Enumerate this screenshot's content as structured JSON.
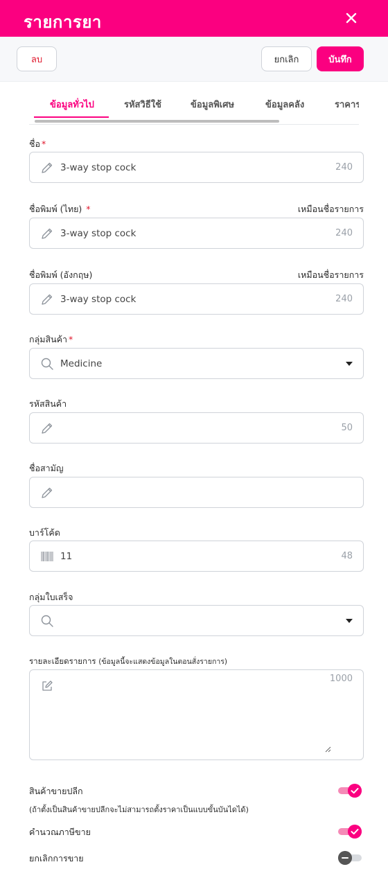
{
  "header": {
    "title": "รายการยา",
    "close_icon": "close-icon"
  },
  "toolbar": {
    "delete_label": "ลบ",
    "cancel_label": "ยกเลิก",
    "save_label": "บันทึก"
  },
  "tabs": [
    {
      "label": "ข้อมูลทั่วไป",
      "active": true
    },
    {
      "label": "รหัสวิธีใช้",
      "active": false
    },
    {
      "label": "ข้อมูลพิเศษ",
      "active": false
    },
    {
      "label": "ข้อมูลคลัง",
      "active": false
    },
    {
      "label": "ราคาร",
      "active": false
    }
  ],
  "form": {
    "name": {
      "label": "ชื่อ",
      "required_mark": "*",
      "value": "3-way stop cock",
      "max": "240",
      "icon": "pencil-icon"
    },
    "print_name_th": {
      "label": "ชื่อพิมพ์ (ไทย)",
      "required_mark": "*",
      "link": "เหมือนชื่อรายการ",
      "value": "3-way stop cock",
      "max": "240",
      "icon": "pencil-icon"
    },
    "print_name_en": {
      "label": "ชื่อพิมพ์ (อังกฤษ)",
      "link": "เหมือนชื่อรายการ",
      "value": "3-way stop cock",
      "max": "240",
      "icon": "pencil-icon"
    },
    "product_group": {
      "label": "กลุ่มสินค้า",
      "required_mark": "*",
      "value": "Medicine",
      "icon": "search-icon"
    },
    "product_code": {
      "label": "รหัสสินค้า",
      "value": "",
      "max": "50",
      "icon": "pencil-icon"
    },
    "generic_name": {
      "label": "ชื่อสามัญ",
      "value": "",
      "icon": "pencil-icon"
    },
    "barcode": {
      "label": "บาร์โค้ด",
      "value": "11",
      "max": "48",
      "icon": "barcode-icon"
    },
    "receipt_group": {
      "label": "กลุ่มใบเสร็จ",
      "value": "",
      "icon": "search-icon"
    },
    "details": {
      "label": "รายละเอียดรายการ",
      "hint": "(ข้อมูลนี้จะแสดงข้อมูลในตอนสั่งรายการ)",
      "max": "1000",
      "icon": "edit-icon"
    }
  },
  "toggles": {
    "retail": {
      "label": "สินค้าขายปลีก",
      "note": "(ถ้าตั้งเป็นสินค้าขายปลีกจะไม่สามารถตั้งราคาเป็นแบบขั้นบันไดได้)",
      "on": true
    },
    "sales_tax": {
      "label": "คำนวณภาษีขาย",
      "on": true
    },
    "cancel_sale": {
      "label": "ยกเลิกการขาย",
      "on": false
    }
  },
  "colors": {
    "accent": "#fb0080",
    "required": "#e0162b"
  }
}
